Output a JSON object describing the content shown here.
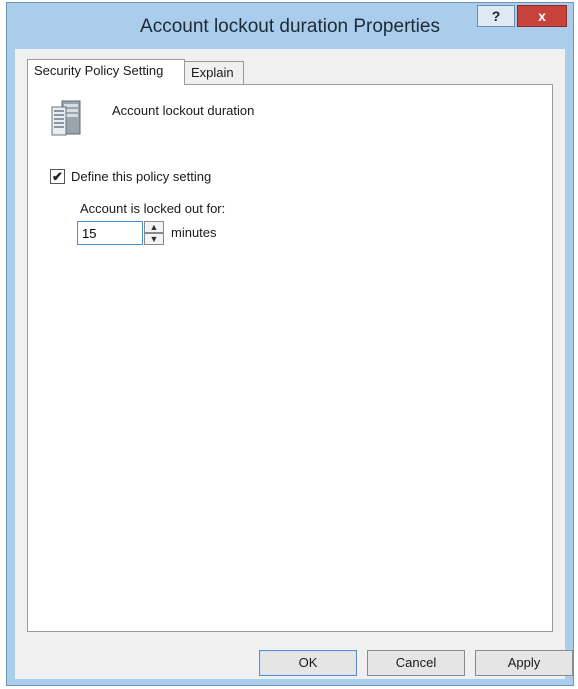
{
  "window": {
    "title": "Account lockout duration Properties",
    "help_label": "?",
    "close_label": "x"
  },
  "tabs": [
    {
      "label": "Security Policy Setting",
      "active": true
    },
    {
      "label": "Explain",
      "active": false
    }
  ],
  "policy": {
    "icon": "server-icon",
    "name": "Account lockout duration"
  },
  "define_setting": {
    "label": "Define this policy setting",
    "checked": true,
    "check_glyph": "✔"
  },
  "lockout": {
    "label": "Account is locked out for:",
    "value": "15",
    "unit": "minutes",
    "up_glyph": "▲",
    "down_glyph": "▼"
  },
  "buttons": {
    "ok": "OK",
    "cancel": "Cancel",
    "apply": "Apply"
  },
  "colors": {
    "frame": "#a9cdea",
    "close": "#c7423a",
    "input_focus": "#4a90d0"
  }
}
